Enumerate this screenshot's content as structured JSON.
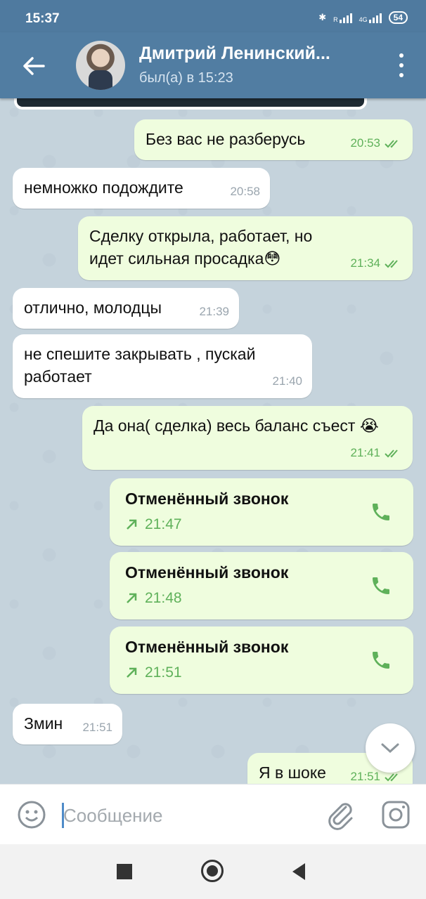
{
  "status_bar": {
    "time": "15:37",
    "network_label_1": "R",
    "network_label_2": "4G",
    "battery": "54"
  },
  "header": {
    "contact_name": "Дмитрий Ленинский...",
    "last_seen": "был(а) в 15:23"
  },
  "messages": [
    {
      "dir": "out",
      "text": "Без  вас не разберусь",
      "time": "20:53"
    },
    {
      "dir": "in",
      "text": "немножко подождите",
      "time": "20:58"
    },
    {
      "dir": "out",
      "text": "Сделку открыла, работает, но идет сильная просадка😳",
      "time": "21:34"
    },
    {
      "dir": "in",
      "text": "отлично, молодцы",
      "time": "21:39"
    },
    {
      "dir": "in",
      "text": "не спешите закрывать , пускай работает",
      "time": "21:40"
    },
    {
      "dir": "out",
      "text": "Да она( сделка) весь баланс съест 😭",
      "time": "21:41"
    },
    {
      "dir": "in",
      "text": "Змин",
      "time": "21:51"
    },
    {
      "dir": "out",
      "text": "Я в шоке",
      "time": "21:51"
    }
  ],
  "calls": [
    {
      "title": "Отменённый звонок",
      "time": "21:47"
    },
    {
      "title": "Отменённый звонок",
      "time": "21:48"
    },
    {
      "title": "Отменённый звонок",
      "time": "21:51"
    }
  ],
  "input": {
    "placeholder": "Сообщение"
  },
  "colors": {
    "header": "#517da2",
    "outgoing_bubble": "#effdde",
    "incoming_bubble": "#ffffff",
    "accent_green": "#5fb15a"
  }
}
